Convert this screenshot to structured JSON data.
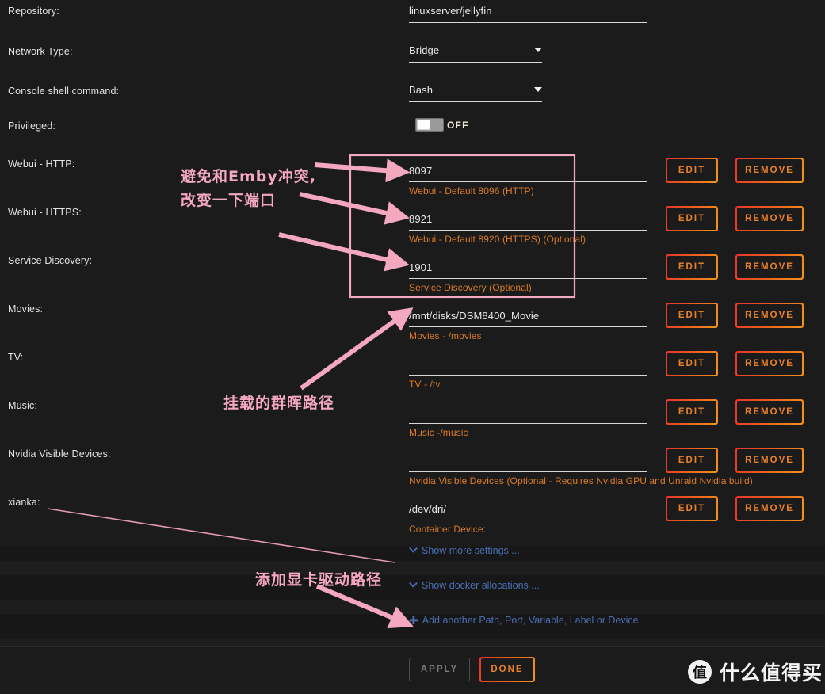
{
  "form": {
    "rows": [
      {
        "label": "Repository:",
        "value": "linuxserver/jellyfin",
        "type": "text",
        "hint": "",
        "buttons": []
      },
      {
        "label": "Network Type:",
        "value": "Bridge",
        "type": "select",
        "hint": "",
        "buttons": []
      },
      {
        "label": "Console shell command:",
        "value": "Bash",
        "type": "select",
        "hint": "",
        "buttons": []
      },
      {
        "label": "Privileged:",
        "value": "OFF",
        "type": "toggle",
        "hint": "",
        "buttons": []
      },
      {
        "label": "Webui - HTTP:",
        "value": "8097",
        "type": "text",
        "hint": "Webui - Default 8096 (HTTP)",
        "buttons": [
          "EDIT",
          "REMOVE"
        ]
      },
      {
        "label": "Webui - HTTPS:",
        "value": "8921",
        "type": "text",
        "hint": "Webui - Default 8920 (HTTPS) (Optional)",
        "buttons": [
          "EDIT",
          "REMOVE"
        ]
      },
      {
        "label": "Service Discovery:",
        "value": "1901",
        "type": "text",
        "hint": "Service Discovery (Optional)",
        "buttons": [
          "EDIT",
          "REMOVE"
        ]
      },
      {
        "label": "Movies:",
        "value": "/mnt/disks/DSM8400_Movie",
        "type": "text",
        "hint": "Movies - /movies",
        "buttons": [
          "EDIT",
          "REMOVE"
        ]
      },
      {
        "label": "TV:",
        "value": "",
        "type": "text",
        "hint": "TV - /tv",
        "buttons": [
          "EDIT",
          "REMOVE"
        ]
      },
      {
        "label": "Music:",
        "value": "",
        "type": "text",
        "hint": "Music -/music",
        "buttons": [
          "EDIT",
          "REMOVE"
        ]
      },
      {
        "label": "Nvidia Visible Devices:",
        "value": "",
        "type": "text",
        "hint": "Nvidia Visible Devices (Optional - Requires Nvidia GPU and Unraid Nvidia build)",
        "buttons": [
          "EDIT",
          "REMOVE"
        ]
      },
      {
        "label": "xianka:",
        "value": "/dev/dri/",
        "type": "text",
        "hint": "Container Device:",
        "buttons": [
          "EDIT",
          "REMOVE"
        ]
      }
    ]
  },
  "links": {
    "show_more_settings": "Show more settings ...",
    "show_docker_allocations": "Show docker allocations ...",
    "add_another": "Add another Path, Port, Variable, Label or Device",
    "chevron_icon": "chevron-down-icon",
    "plus_icon": "plus-icon"
  },
  "footer": {
    "apply_label": "APPLY",
    "done_label": "DONE"
  },
  "watermark": {
    "logo_char": "值",
    "text": "什么值得买"
  },
  "annotations": {
    "ports_note_line1": "避免和Emby冲突,",
    "ports_note_line2": "改变一下端口",
    "mount_note": "挂载的群晖路径",
    "gpu_note": "添加显卡驱动路径",
    "highlight_color": "#f4a8c0"
  },
  "colors": {
    "background": "#1b1b1b",
    "hint_orange": "#d97b28",
    "link_blue": "#4a6fb5",
    "button_gradient_start": "#e8332a",
    "button_gradient_end": "#f2951b",
    "annotation_pink": "#f4a8c0"
  }
}
